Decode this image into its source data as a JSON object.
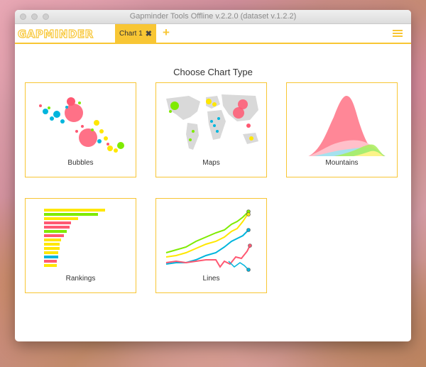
{
  "window": {
    "title": "Gapminder Tools Offline v.2.2.0 (dataset v.1.2.2)"
  },
  "appbar": {
    "logo_text": "GAPMINDER",
    "tab_label": "Chart 1",
    "tab_close_symbol": "✖",
    "add_symbol": "+",
    "brand_color": "#f8c634"
  },
  "main": {
    "heading": "Choose Chart Type",
    "charts": [
      {
        "label": "Bubbles",
        "icon": "bubbles-preview"
      },
      {
        "label": "Maps",
        "icon": "maps-preview"
      },
      {
        "label": "Mountains",
        "icon": "mountains-preview"
      },
      {
        "label": "Rankings",
        "icon": "rankings-preview"
      },
      {
        "label": "Lines",
        "icon": "lines-preview"
      }
    ]
  }
}
